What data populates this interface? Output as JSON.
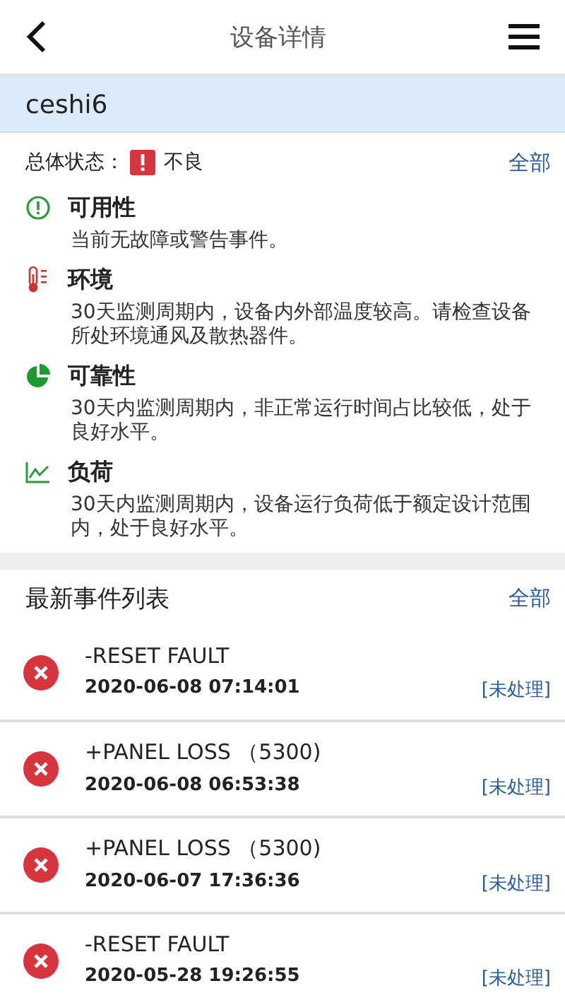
{
  "header": {
    "title": "设备详情"
  },
  "device": {
    "name": "ceshi6"
  },
  "overall": {
    "label": "总体状态：",
    "kind": "error",
    "value": "不良",
    "link": "全部"
  },
  "categories": [
    {
      "kind": "availability",
      "title": "可用性",
      "text": "当前无故障或警告事件。"
    },
    {
      "kind": "environment",
      "title": "环境",
      "text": "30天监测周期内，设备内外部温度较高。请检查设备所处环境通风及散热器件。"
    },
    {
      "kind": "reliability",
      "title": "可靠性",
      "text": "30天内监测周期内，非正常运行时间占比较低，处于良好水平。"
    },
    {
      "kind": "load",
      "title": "负荷",
      "text": "30天内监测周期内，设备运行负荷低于额定设计范围内，处于良好水平。"
    }
  ],
  "events": {
    "title": "最新事件列表",
    "link": "全部",
    "items": [
      {
        "kind": "error",
        "name": "-RESET FAULT",
        "time": "2020-06-08 07:14:01",
        "status": "[未处理]"
      },
      {
        "kind": "error",
        "name": "+PANEL LOSS （5300)",
        "time": "2020-06-08 06:53:38",
        "status": "[未处理]"
      },
      {
        "kind": "error",
        "name": "+PANEL LOSS （5300)",
        "time": "2020-06-07 17:36:36",
        "status": "[未处理]"
      },
      {
        "kind": "error",
        "name": "-RESET FAULT",
        "time": "2020-05-28 19:26:55",
        "status": "[未处理]"
      }
    ]
  }
}
